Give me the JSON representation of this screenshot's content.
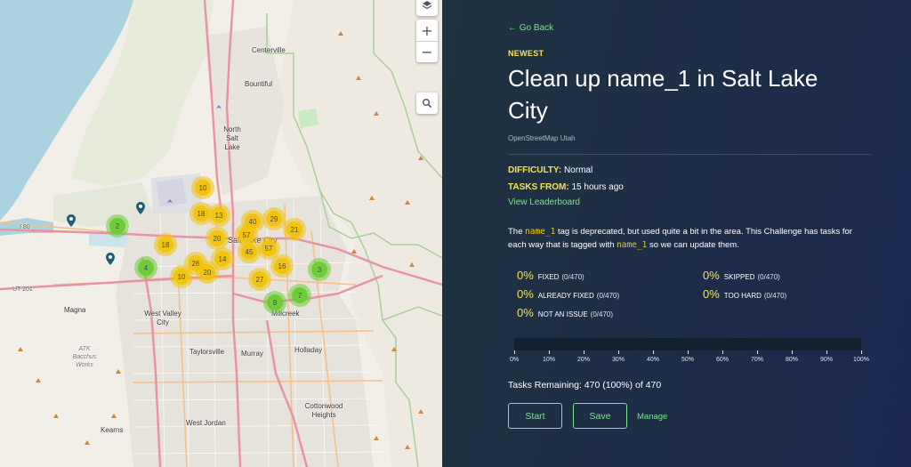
{
  "map": {
    "places": [
      {
        "name": "Centerville",
        "cls": "place"
      },
      {
        "name": "Bountiful",
        "cls": "place"
      },
      {
        "name": "North Salt Lake",
        "cls": "place"
      },
      {
        "name": "Salt Lake City",
        "cls": "place"
      },
      {
        "name": "Magna",
        "cls": "place"
      },
      {
        "name": "West Valley City",
        "cls": "place"
      },
      {
        "name": "Taylorsville",
        "cls": "place"
      },
      {
        "name": "Murray",
        "cls": "place"
      },
      {
        "name": "Millcreek",
        "cls": "place"
      },
      {
        "name": "Holladay",
        "cls": "place"
      },
      {
        "name": "Cottonwood Heights",
        "cls": "place"
      },
      {
        "name": "West Jordan",
        "cls": "place"
      },
      {
        "name": "Kearns",
        "cls": "place"
      },
      {
        "name": "ATK Bacchus Works",
        "cls": "place it"
      },
      {
        "name": "I 80",
        "cls": "place sm"
      },
      {
        "name": "UT 201",
        "cls": "place sm"
      }
    ],
    "clusters": [
      {
        "label": "10",
        "color": "y"
      },
      {
        "label": "18",
        "color": "y"
      },
      {
        "label": "13",
        "color": "y"
      },
      {
        "label": "2",
        "color": "g"
      },
      {
        "label": "18",
        "color": "y"
      },
      {
        "label": "20",
        "color": "y"
      },
      {
        "label": "40",
        "color": "y"
      },
      {
        "label": "29",
        "color": "y"
      },
      {
        "label": "21",
        "color": "y"
      },
      {
        "label": "57",
        "color": "y"
      },
      {
        "label": "45",
        "color": "y"
      },
      {
        "label": "57",
        "color": "y"
      },
      {
        "label": "4",
        "color": "g"
      },
      {
        "label": "26",
        "color": "y"
      },
      {
        "label": "14",
        "color": "y"
      },
      {
        "label": "20",
        "color": "y"
      },
      {
        "label": "10",
        "color": "y"
      },
      {
        "label": "16",
        "color": "y"
      },
      {
        "label": "3",
        "color": "g"
      },
      {
        "label": "27",
        "color": "y"
      },
      {
        "label": "7",
        "color": "g"
      },
      {
        "label": "8",
        "color": "g"
      }
    ]
  },
  "panel": {
    "go_back": "← Go Back",
    "badge": "NEWEST",
    "title": "Clean up name_1 in Salt Lake City",
    "owner": "OpenStreetMap Utah",
    "difficulty_label": "DIFFICULTY:",
    "difficulty_value": "Normal",
    "tasks_from_label": "TASKS FROM:",
    "tasks_from_value": "15 hours ago",
    "leaderboard": "View Leaderboard",
    "desc": {
      "p1": "The ",
      "code1": "name_1",
      "p2": " tag is deprecated, but used quite a bit in the area. This Challenge has tasks for each way that is tagged with ",
      "code2": "name_1",
      "p3": " so we can update them."
    },
    "stats": [
      {
        "pct": "0%",
        "label": "FIXED",
        "count": "(0/470)"
      },
      {
        "pct": "0%",
        "label": "SKIPPED",
        "count": "(0/470)"
      },
      {
        "pct": "0%",
        "label": "ALREADY FIXED",
        "count": "(0/470)"
      },
      {
        "pct": "0%",
        "label": "TOO HARD",
        "count": "(0/470)"
      },
      {
        "pct": "0%",
        "label": "NOT AN ISSUE",
        "count": "(0/470)"
      }
    ],
    "progress_fraction": 0,
    "ticks": [
      "0%",
      "10%",
      "20%",
      "30%",
      "40%",
      "50%",
      "60%",
      "70%",
      "80%",
      "90%",
      "100%"
    ],
    "remaining": "Tasks Remaining: 470 (100%) of 470",
    "start_label": "Start",
    "save_label": "Save",
    "manage_label": "Manage"
  },
  "colors": {
    "accent_green": "#7ee28f",
    "accent_yellow": "#f5e35e",
    "cluster_yellow": "#f1c40f",
    "cluster_green": "#6ecc39"
  }
}
